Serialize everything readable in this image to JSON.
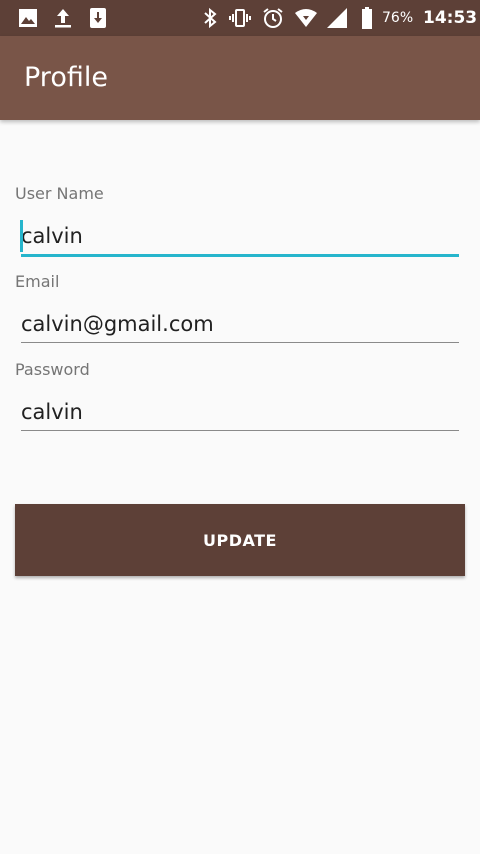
{
  "status_bar": {
    "left_icons": [
      "image-icon",
      "upload-icon",
      "download-icon"
    ],
    "right_icons": [
      "bluetooth-icon",
      "vibrate-icon",
      "alarm-icon",
      "wifi-icon",
      "signal-icon",
      "battery-icon"
    ],
    "battery_percent": "76%",
    "time": "14:53"
  },
  "app_bar": {
    "title": "Profile"
  },
  "form": {
    "username": {
      "label": "User Name",
      "value": "calvin"
    },
    "email": {
      "label": "Email",
      "value": "calvin@gmail.com"
    },
    "password": {
      "label": "Password",
      "value": "calvin"
    }
  },
  "update_button": {
    "label": "UPDATE"
  },
  "colors": {
    "status_bar": "#5d4037",
    "app_bar": "#795548",
    "button": "#5d4037",
    "accent": "#26b5cc",
    "background": "#fafafa"
  }
}
